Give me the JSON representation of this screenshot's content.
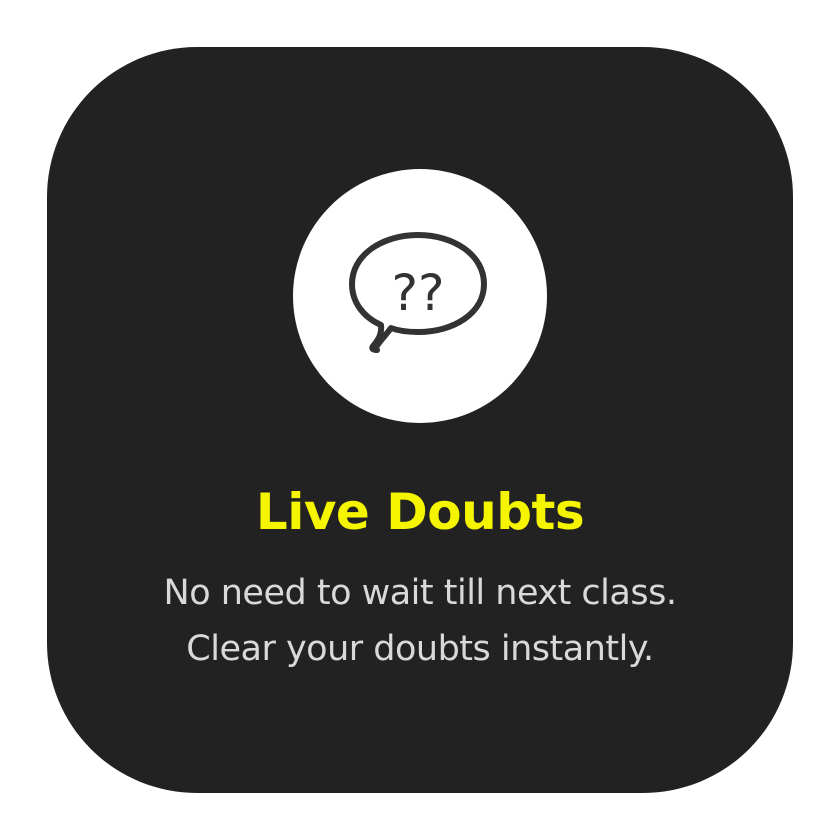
{
  "card": {
    "icon": "speech-bubble-question-icon",
    "icon_glyph": "??",
    "title": "Live Doubts",
    "description_line1": "No need to wait till next class.",
    "description_line2": "Clear your doubts instantly."
  },
  "colors": {
    "card_background": "#222222",
    "title": "#f5f500",
    "description": "#d9d9d9",
    "icon_circle": "#ffffff",
    "icon_stroke": "#333333"
  }
}
